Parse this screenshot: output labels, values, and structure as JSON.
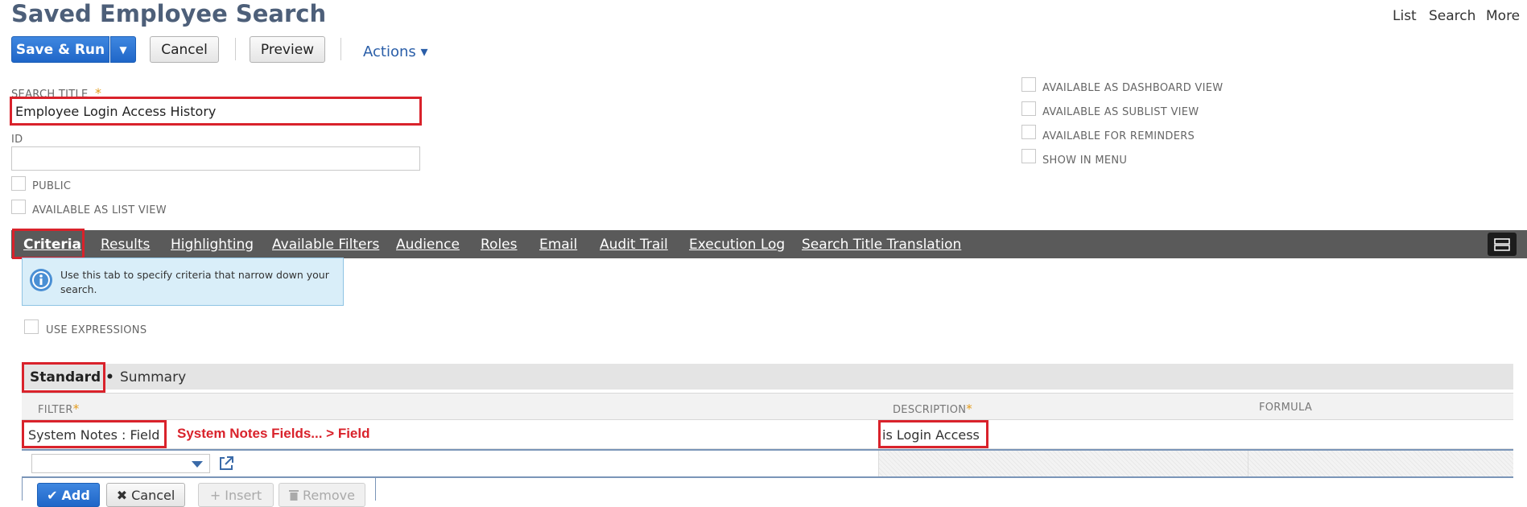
{
  "page": {
    "title": "Saved Employee Search"
  },
  "topnav": {
    "list": "List",
    "search": "Search",
    "more": "More"
  },
  "toolbar": {
    "save_run": "Save & Run",
    "dropdown_arrow": "▼",
    "cancel": "Cancel",
    "preview": "Preview",
    "actions": "Actions ▾"
  },
  "form": {
    "search_title_label": "SEARCH TITLE",
    "required_mark": "*",
    "search_title_value": "Employee Login Access History",
    "id_label": "ID",
    "id_value": "",
    "public_label": "PUBLIC",
    "list_view_label": "AVAILABLE AS LIST VIEW",
    "dashboard_label": "AVAILABLE AS DASHBOARD VIEW",
    "sublist_label": "AVAILABLE AS SUBLIST VIEW",
    "reminders_label": "AVAILABLE FOR REMINDERS",
    "menu_label": "SHOW IN MENU"
  },
  "tabs": [
    {
      "label": "Criteria"
    },
    {
      "label": "Results"
    },
    {
      "label": "Highlighting"
    },
    {
      "label": "Available Filters"
    },
    {
      "label": "Audience"
    },
    {
      "label": "Roles"
    },
    {
      "label": "Email"
    },
    {
      "label": "Audit Trail"
    },
    {
      "label": "Execution Log"
    },
    {
      "label": "Search Title Translation"
    }
  ],
  "info": {
    "text": "Use this tab to specify criteria that narrow down your search."
  },
  "criteria": {
    "use_expressions": "USE EXPRESSIONS",
    "subtab_standard": "Standard •",
    "subtab_summary": "Summary",
    "col_filter": "FILTER",
    "col_description": "DESCRIPTION",
    "col_formula": "FORMULA",
    "row_filter": "System Notes : Field",
    "row_description": "is Login Access",
    "annotation": "System Notes Fields... > Field",
    "add": "Add",
    "cancel": "Cancel",
    "insert": "Insert",
    "remove": "Remove"
  },
  "colors": {
    "accent": "#1f66c8",
    "annotation_red": "#d9222b",
    "tabbar": "#5a5a5a",
    "title": "#4d5f79"
  }
}
